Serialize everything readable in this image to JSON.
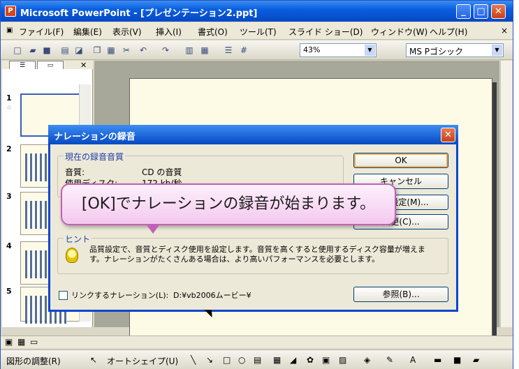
{
  "window": {
    "title": "Microsoft PowerPoint - [プレゼンテーション2.ppt]",
    "app_icon": "powerpoint-icon",
    "minimize": "_",
    "maximize": "□",
    "close": "✕"
  },
  "menubar": {
    "items": [
      "ファイル(F)",
      "編集(E)",
      "表示(V)",
      "挿入(I)",
      "書式(O)",
      "ツール(T)",
      "スライド ショー(D)",
      "ウィンドウ(W)",
      "ヘルプ(H)"
    ],
    "close_glyph": "×"
  },
  "toolbar": {
    "zoom": "43%",
    "font": "MS Pゴシック"
  },
  "slides_pane": {
    "numbers": [
      "1",
      "2",
      "3",
      "4",
      "5"
    ]
  },
  "dialog": {
    "title": "ナレーションの録音",
    "group_quality": "現在の録音音質",
    "quality_label": "音質:",
    "quality_value": "CD の音質",
    "disk_label": "使用ディスク:",
    "disk_value": "172 kb/秒",
    "ok": "OK",
    "cancel": "キャンセル",
    "set_quality": "音質設定(M)...",
    "change_mic": "変更(C)...",
    "hint_title": "ヒント",
    "hint_text": "品質設定で、音質とディスク使用を設定します。音質を高くすると使用するディスク容量が増えます。ナレーションがたくさんある場合は、より高いパフォーマンスを必要とします。",
    "link_label": "リンクするナレーション(L):",
    "link_path": "D:¥vb2006ムービー¥",
    "browse": "参照(B)..."
  },
  "callout": {
    "text": "[OK]でナレーションの録音が始まります。"
  },
  "drawbar": {
    "adjust": "図形の調整(R)",
    "autoshape": "オートシェイプ(U)"
  },
  "colors": {
    "titlebar": "#0a5fe0",
    "callout_border": "#c35fb5"
  }
}
